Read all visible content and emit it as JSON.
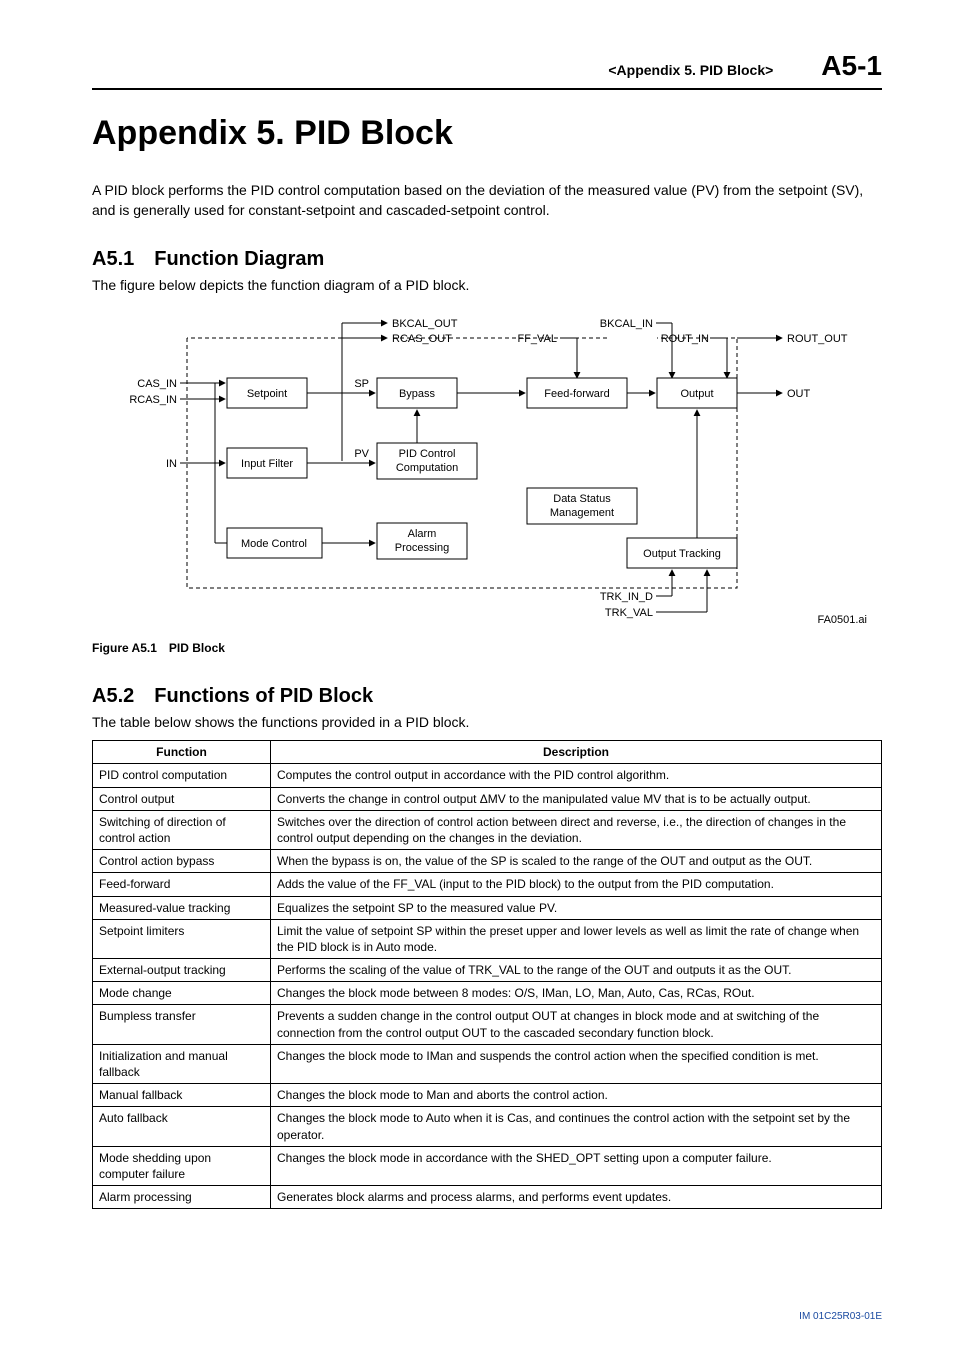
{
  "header": {
    "section_label": "<Appendix 5. PID Block>",
    "page_no": "A5-1"
  },
  "title": "Appendix 5.  PID Block",
  "intro": "A PID block performs the PID control computation based on the deviation of the measured value (PV) from the setpoint (SV), and is generally used for constant-setpoint and cascaded-setpoint control.",
  "section1": {
    "heading": "A5.1 Function Diagram",
    "intro": "The figure below depicts the function diagram of a PID block.",
    "figcap": "Figure A5.1 PID Block"
  },
  "diagram": {
    "inputs_left": {
      "cas_in": "CAS_IN",
      "rcas_in": "RCAS_IN",
      "in": "IN"
    },
    "top_out": {
      "bkcal_out": "BKCAL_OUT",
      "rcas_out": "RCAS_OUT"
    },
    "top_in": {
      "ff_val": "FF_VAL",
      "bkcal_in": "BKCAL_IN",
      "rout_in": "ROUT_IN"
    },
    "right_out": {
      "rout_out": "ROUT_OUT",
      "out": "OUT"
    },
    "boxes": {
      "setpoint": "Setpoint",
      "bypass": "Bypass",
      "feedforward": "Feed-forward",
      "output": "Output",
      "input_filter": "Input Filter",
      "pid_l1": "PID Control",
      "pid_l2": "Computation",
      "data_l1": "Data Status",
      "data_l2": "Management",
      "mode_control": "Mode Control",
      "alarm_l1": "Alarm",
      "alarm_l2": "Processing",
      "output_tracking": "Output Tracking"
    },
    "edges": {
      "sp": "SP",
      "pv": "PV"
    },
    "bottom_in": {
      "trk_in_d": "TRK_IN_D",
      "trk_val": "TRK_VAL"
    },
    "figure_ref": "FA0501.ai"
  },
  "section2": {
    "heading": "A5.2 Functions of PID Block",
    "intro": "The table below shows the functions provided in a PID block.",
    "th_fn": "Function",
    "th_desc": "Description",
    "rows": [
      {
        "fn": "PID control computation",
        "desc": "Computes the control output in accordance with the PID control algorithm."
      },
      {
        "fn": "Control output",
        "desc": "Converts the change in control output ΔMV to the manipulated value MV that is to be actually output."
      },
      {
        "fn": "Switching of direction of control action",
        "desc": "Switches over the direction of control action between direct and reverse, i.e., the direction of changes in the control output depending on the changes in the deviation."
      },
      {
        "fn": "Control action bypass",
        "desc": "When the bypass is on, the value of the SP is scaled to the range of the OUT and output as the OUT."
      },
      {
        "fn": "Feed-forward",
        "desc": "Adds the value of the FF_VAL (input to the PID block) to the output from the PID computation."
      },
      {
        "fn": "Measured-value tracking",
        "desc": "Equalizes the setpoint SP to the measured value PV."
      },
      {
        "fn": "Setpoint limiters",
        "desc": "Limit the value of setpoint SP within the preset upper and lower levels as well as limit the rate of change when the PID block is in Auto mode."
      },
      {
        "fn": "External-output tracking",
        "desc": "Performs the scaling of the value of TRK_VAL to the range of the OUT and outputs it as the OUT."
      },
      {
        "fn": "Mode change",
        "desc": "Changes the block mode between 8 modes: O/S, IMan, LO, Man, Auto, Cas, RCas, ROut."
      },
      {
        "fn": "Bumpless transfer",
        "desc": "Prevents a sudden change in the control output OUT at changes in block mode and at switching of the connection from the control output OUT to the cascaded secondary function block."
      },
      {
        "fn": "Initialization and manual fallback",
        "desc": "Changes the block mode to IMan and suspends the control action when the specified condition is met."
      },
      {
        "fn": "Manual fallback",
        "desc": "Changes the block mode to Man and aborts the control action."
      },
      {
        "fn": "Auto fallback",
        "desc": "Changes the block mode to Auto when it is Cas, and continues the control action with the setpoint set by the operator."
      },
      {
        "fn": "Mode shedding upon computer failure",
        "desc": "Changes the block mode in accordance with the SHED_OPT setting upon a computer failure."
      },
      {
        "fn": "Alarm processing",
        "desc": "Generates block alarms and process alarms, and performs event updates."
      }
    ]
  },
  "doc_id": "IM 01C25R03-01E"
}
